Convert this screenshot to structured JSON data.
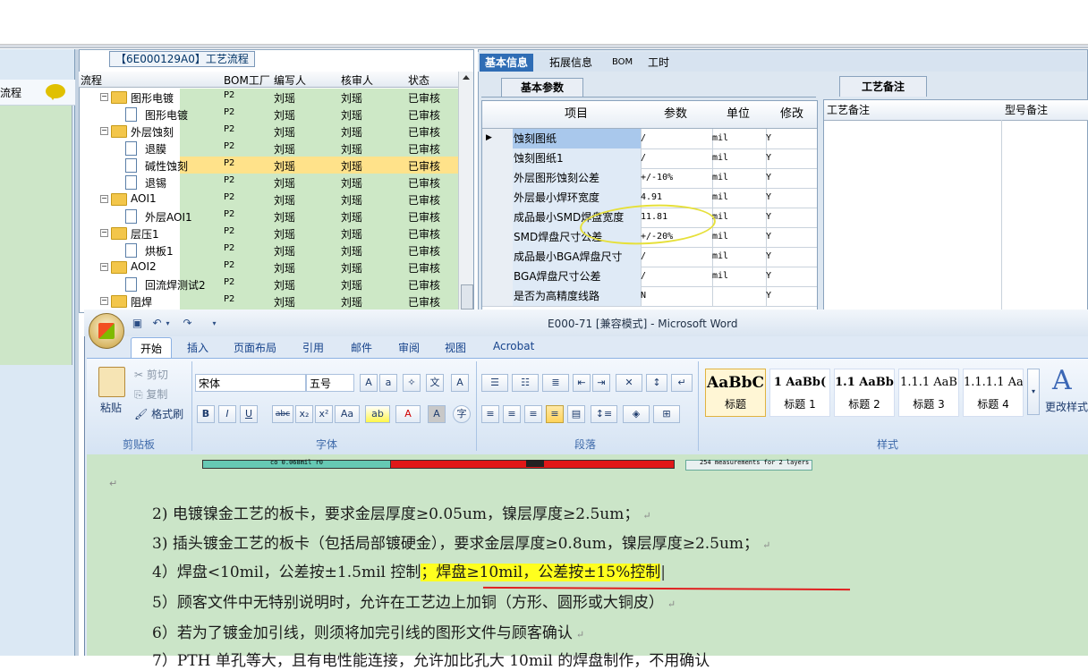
{
  "left_nav": {
    "item_label": "流程"
  },
  "process_tree": {
    "title": "【6E000129A0】工艺流程",
    "columns": [
      "流程",
      "BOM工厂",
      "编写人",
      "核审人",
      "状态"
    ],
    "rows": [
      {
        "name": "图形电镀",
        "kind": "folder",
        "factory": "P2",
        "author": "刘瑶",
        "reviewer": "刘瑶",
        "status": "已审核"
      },
      {
        "name": "图形电镀",
        "kind": "doc",
        "factory": "P2",
        "author": "刘瑶",
        "reviewer": "刘瑶",
        "status": "已审核"
      },
      {
        "name": "外层蚀刻",
        "kind": "folder",
        "factory": "P2",
        "author": "刘瑶",
        "reviewer": "刘瑶",
        "status": "已审核"
      },
      {
        "name": "退膜",
        "kind": "doc",
        "factory": "P2",
        "author": "刘瑶",
        "reviewer": "刘瑶",
        "status": "已审核"
      },
      {
        "name": "碱性蚀刻",
        "kind": "doc",
        "factory": "P2",
        "author": "刘瑶",
        "reviewer": "刘瑶",
        "status": "已审核",
        "selected": true
      },
      {
        "name": "退锡",
        "kind": "doc",
        "factory": "P2",
        "author": "刘瑶",
        "reviewer": "刘瑶",
        "status": "已审核"
      },
      {
        "name": "AOI1",
        "kind": "folder",
        "factory": "P2",
        "author": "刘瑶",
        "reviewer": "刘瑶",
        "status": "已审核"
      },
      {
        "name": "外层AOI1",
        "kind": "doc",
        "factory": "P2",
        "author": "刘瑶",
        "reviewer": "刘瑶",
        "status": "已审核"
      },
      {
        "name": "层压1",
        "kind": "folder",
        "factory": "P2",
        "author": "刘瑶",
        "reviewer": "刘瑶",
        "status": "已审核"
      },
      {
        "name": "烘板1",
        "kind": "doc",
        "factory": "P2",
        "author": "刘瑶",
        "reviewer": "刘瑶",
        "status": "已审核"
      },
      {
        "name": "AOI2",
        "kind": "folder",
        "factory": "P2",
        "author": "刘瑶",
        "reviewer": "刘瑶",
        "status": "已审核"
      },
      {
        "name": "回流焊测试2",
        "kind": "doc",
        "factory": "P2",
        "author": "刘瑶",
        "reviewer": "刘瑶",
        "status": "已审核"
      },
      {
        "name": "阻焊",
        "kind": "folder",
        "factory": "P2",
        "author": "刘瑶",
        "reviewer": "刘瑶",
        "status": "已审核"
      }
    ]
  },
  "info_panel": {
    "tabs": [
      "基本信息",
      "拓展信息",
      "BOM",
      "工时"
    ],
    "sub_tab": "基本参数",
    "columns": [
      "项目",
      "参数",
      "单位",
      "修改"
    ],
    "rows": [
      {
        "item": "蚀刻图纸",
        "param": "/",
        "unit": "mil",
        "mod": "Y"
      },
      {
        "item": "蚀刻图纸1",
        "param": "/",
        "unit": "mil",
        "mod": "Y"
      },
      {
        "item": "外层图形蚀刻公差",
        "param": "+/-10%",
        "unit": "mil",
        "mod": "Y"
      },
      {
        "item": "外层最小焊环宽度",
        "param": "4.91",
        "unit": "mil",
        "mod": "Y"
      },
      {
        "item": "成品最小SMD焊盘宽度",
        "param": "11.81",
        "unit": "mil",
        "mod": "Y"
      },
      {
        "item": "SMD焊盘尺寸公差",
        "param": "+/-20%",
        "unit": "mil",
        "mod": "Y"
      },
      {
        "item": "成品最小BGA焊盘尺寸",
        "param": "/",
        "unit": "mil",
        "mod": "Y"
      },
      {
        "item": "BGA焊盘尺寸公差",
        "param": "/",
        "unit": "mil",
        "mod": "Y"
      },
      {
        "item": "是否为高精度线路",
        "param": "N",
        "unit": "",
        "mod": "Y"
      }
    ],
    "remark_tab": "工艺备注",
    "remark_columns": [
      "工艺备注",
      "型号备注"
    ]
  },
  "word": {
    "title": "E000-71 [兼容模式] - Microsoft Word",
    "tabs": [
      "开始",
      "插入",
      "页面布局",
      "引用",
      "邮件",
      "审阅",
      "视图",
      "Acrobat"
    ],
    "clipboard": {
      "paste": "粘贴",
      "cut": "剪切",
      "copy": "复制",
      "format_painter": "格式刷",
      "label": "剪贴板"
    },
    "font": {
      "name": "宋体",
      "size": "五号",
      "label": "字体"
    },
    "paragraph": {
      "label": "段落"
    },
    "styles": {
      "label": "样式",
      "items": [
        {
          "preview": "AaBbC",
          "name": "标题"
        },
        {
          "preview": "1 AaBb(",
          "name": "标题 1"
        },
        {
          "preview": "1.1 AaBb",
          "name": "标题 2"
        },
        {
          "preview": "1.1.1 AaB",
          "name": "标题 3"
        },
        {
          "preview": "1.1.1.1 Aa",
          "name": "标题 4"
        }
      ],
      "change_styles": "更改样式"
    },
    "doc_image_text": "co 0.068mil  r0",
    "doc_image_text2": "254 measurements for 2 layers",
    "doc_lines": [
      "2)  电镀镍金工艺的板卡，要求金层厚度≥0.05um，镍层厚度≥2.5um；",
      "3)  插头镀金工艺的板卡（包括局部镀硬金），要求金层厚度≥0.8um，镍层厚度≥2.5um；",
      "4）焊盘<10mil，公差按±1.5mil 控制",
      "；焊盘≥10mil，公差按±15%控制",
      "5）顾客文件中无特别说明时，允许在工艺边上加铜（方形、圆形或大铜皮）",
      "6）若为了镀金加引线，则须将加完引线的图形文件与顾客确认",
      "7）PTH 单孔等大，且有电性能连接，允许加比孔大 10mil 的焊盘制作，不用确认"
    ]
  }
}
